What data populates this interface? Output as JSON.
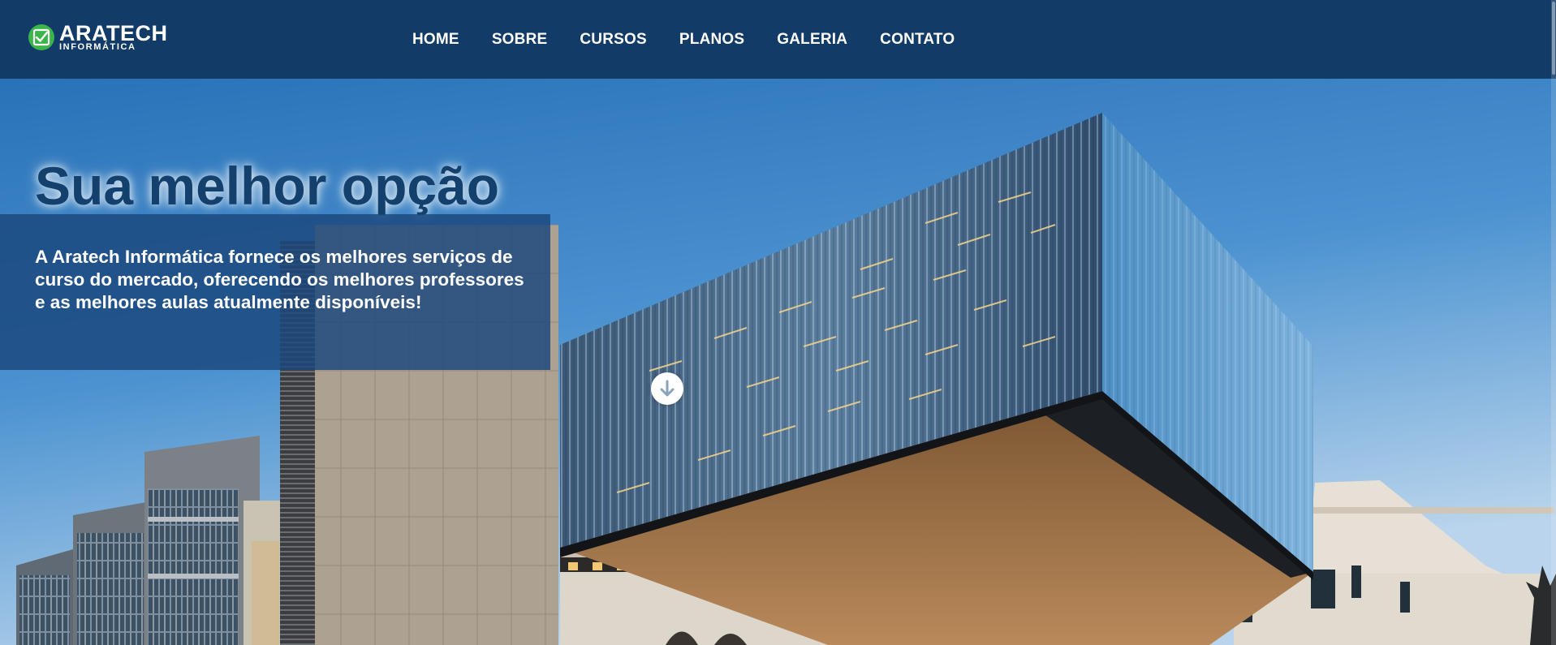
{
  "header": {
    "logo": {
      "title": "ARATECH",
      "subtitle": "INFORMÁTICA",
      "icon": "checkmark-badge-icon"
    },
    "nav": [
      {
        "label": "HOME"
      },
      {
        "label": "SOBRE"
      },
      {
        "label": "CURSOS"
      },
      {
        "label": "PLANOS"
      },
      {
        "label": "GALERIA"
      },
      {
        "label": "CONTATO"
      }
    ]
  },
  "hero": {
    "title": "Sua melhor opção",
    "description": "A Aratech Informática fornece os melhores serviços de curso do mercado, oferecendo os melhores professores e as melhores aulas atualmente disponíveis!",
    "scroll_icon": "arrow-down-circle-icon",
    "background": "modern-glass-building-photo"
  },
  "colors": {
    "header_bg": "#123b68",
    "hero_box_bg": "#1b497e",
    "hero_title": "#14406e",
    "logo_green": "#3bb54a",
    "nav_text": "#ffffff"
  }
}
